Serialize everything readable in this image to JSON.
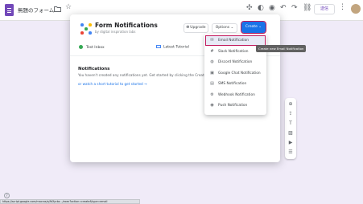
{
  "header": {
    "doc_title": "無題のフォーム",
    "send_label": "送信",
    "icons": [
      "folder-icon",
      "star-icon",
      "puzzle-icon",
      "palette-icon",
      "preview-icon",
      "undo-icon",
      "redo-icon",
      "link-icon",
      "more-icon"
    ]
  },
  "dialog": {
    "title": "Form Notifications",
    "subtitle": "by digital inspiration labs",
    "upgrade_label": "Upgrade",
    "options_label": "Options ⌄",
    "create_label": "Create ⌄",
    "status_left": "Test Inbox",
    "status_right": "Latest Tutorial",
    "notifications_heading": "Notifications",
    "notifications_empty": "You haven't created any notifications yet. Get started by clicking the Create b",
    "notifications_link": "or watch a short tutorial to get started →"
  },
  "menu": {
    "items": [
      {
        "label": "Email Notification",
        "icon": "mail-icon",
        "glyph": "✉",
        "selected": true
      },
      {
        "label": "Slack Notification",
        "icon": "slack-icon",
        "glyph": "#"
      },
      {
        "label": "Discord Notification",
        "icon": "discord-icon",
        "glyph": "◍"
      },
      {
        "label": "Google Chat Notification",
        "icon": "chat-icon",
        "glyph": "▣"
      },
      {
        "label": "SMS Notification",
        "icon": "sms-icon",
        "glyph": "▤"
      },
      {
        "label": "Webhook Notification",
        "icon": "webhook-icon",
        "glyph": "⚙"
      },
      {
        "label": "Push Notification",
        "icon": "bell-icon",
        "glyph": "◉"
      }
    ]
  },
  "tooltip": "Create new Email Notification",
  "status_url": "https://script.google.com/macros/s/AKfycbz.../exec?action=create&type=email"
}
